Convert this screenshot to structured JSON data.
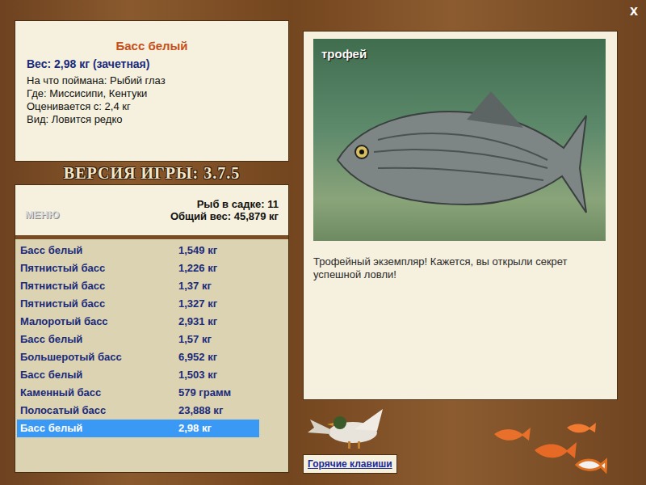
{
  "window": {
    "close": "x"
  },
  "catch": {
    "title": "Басс белый",
    "weight": "Вес: 2,98 кг (зачетная)",
    "details": [
      "На что поймана: Рыбий глаз",
      "Где: Миссисипи, Кентуки",
      "Оценивается с: 2,4 кг",
      "Вид: Ловится редко"
    ]
  },
  "version": "ВЕРСИЯ ИГРЫ: 3.7.5",
  "keep": {
    "menu": "МЕНЮ",
    "count": "Рыб в садке: 11",
    "total": "Общий вес: 45,879 кг",
    "rows": [
      {
        "name": "Басс белый",
        "weight": "1,549 кг",
        "selected": false
      },
      {
        "name": "Пятнистый басс",
        "weight": "1,226 кг",
        "selected": false
      },
      {
        "name": "Пятнистый басс",
        "weight": "1,37 кг",
        "selected": false
      },
      {
        "name": "Пятнистый басс",
        "weight": "1,327 кг",
        "selected": false
      },
      {
        "name": "Малоротый басс",
        "weight": "2,931 кг",
        "selected": false
      },
      {
        "name": "Басс белый",
        "weight": "1,57 кг",
        "selected": false
      },
      {
        "name": "Большеротый басс",
        "weight": "6,952 кг",
        "selected": false
      },
      {
        "name": "Басс белый",
        "weight": "1,503 кг",
        "selected": false
      },
      {
        "name": "Каменный басс",
        "weight": "579 грамм",
        "selected": false
      },
      {
        "name": "Полосатый басс",
        "weight": "23,888 кг",
        "selected": false
      },
      {
        "name": "Басс белый",
        "weight": "2,98 кг",
        "selected": true
      }
    ]
  },
  "photo": {
    "badge": "трофей"
  },
  "description": "Трофейный экземпляр! Кажется, вы открыли секрет успешной ловли!",
  "hotkeys": "Горячие клавиши"
}
